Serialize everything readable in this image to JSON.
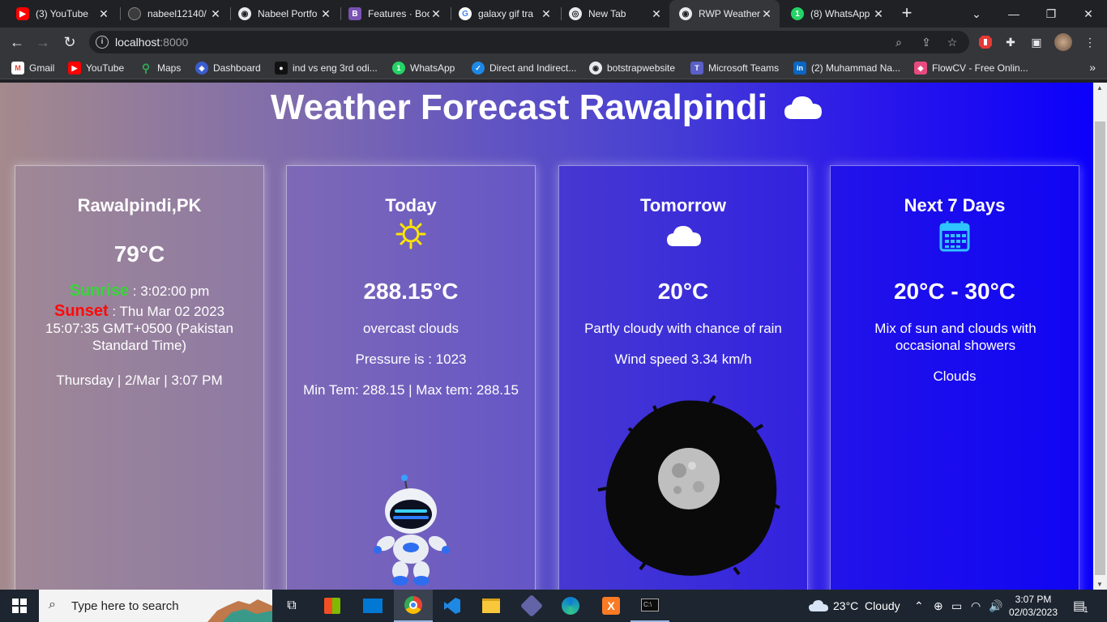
{
  "browser": {
    "tabs": [
      {
        "title": "(3) YouTube",
        "icon": "youtube-icon",
        "color": "#ff0000"
      },
      {
        "title": "nabeel12140/",
        "icon": "github-icon",
        "color": "#24292f"
      },
      {
        "title": "Nabeel Portfo",
        "icon": "globe-icon",
        "color": "#5f6368"
      },
      {
        "title": "Features · Boo",
        "icon": "bootstrap-icon",
        "color": "#7952b3"
      },
      {
        "title": "galaxy gif tra",
        "icon": "google-icon",
        "color": "#4285f4"
      },
      {
        "title": "New Tab",
        "icon": "chrome-icon",
        "color": "#5f6368"
      },
      {
        "title": "RWP Weather",
        "icon": "globe-icon",
        "color": "#5f6368"
      },
      {
        "title": "(8) WhatsApp",
        "icon": "whatsapp-icon",
        "color": "#25d366"
      }
    ],
    "url_host": "localhost",
    "url_port": ":8000",
    "bookmarks": [
      {
        "label": "Gmail",
        "icon": "gmail-icon",
        "color": "#ea4335"
      },
      {
        "label": "YouTube",
        "icon": "youtube-icon",
        "color": "#ff0000"
      },
      {
        "label": "Maps",
        "icon": "maps-icon",
        "color": "#34a853"
      },
      {
        "label": "Dashboard",
        "icon": "dashboard-icon",
        "color": "#3b5ccc"
      },
      {
        "label": "ind vs eng 3rd odi...",
        "icon": "page-icon",
        "color": "#111111"
      },
      {
        "label": "WhatsApp",
        "icon": "whatsapp-icon",
        "color": "#25d366"
      },
      {
        "label": "Direct and Indirect...",
        "icon": "messenger-icon",
        "color": "#1e88e5"
      },
      {
        "label": "botstrapwebsite",
        "icon": "globe-icon",
        "color": "#5f6368"
      },
      {
        "label": "Microsoft Teams",
        "icon": "teams-icon",
        "color": "#5b5fc7"
      },
      {
        "label": "(2) Muhammad Na...",
        "icon": "linkedin-icon",
        "color": "#0a66c2"
      },
      {
        "label": "FlowCV - Free Onlin...",
        "icon": "flowcv-icon",
        "color": "#e84a7f"
      }
    ]
  },
  "page": {
    "title": "Weather Forecast Rawalpindi",
    "current": {
      "city": "Rawalpindi,PK",
      "temp": "79°C",
      "sunrise_label": "Sunrise",
      "sunrise_value": " : 3:02:00 pm",
      "sunset_label": "Sunset",
      "sunset_value": " : Thu Mar 02 2023 15:07:35 GMT+0500 (Pakistan Standard Time)",
      "date": "Thursday | 2/Mar | 3:07 PM"
    },
    "today": {
      "heading": "Today",
      "temp": "288.15°C",
      "desc": "overcast clouds",
      "pressure": "Pressure is : 1023",
      "minmax": "Min Tem: 288.15 | Max tem: 288.15"
    },
    "tomorrow": {
      "heading": "Tomorrow",
      "temp": "20°C",
      "desc": "Partly cloudy with chance of rain",
      "wind": "Wind speed 3.34 km/h"
    },
    "week": {
      "heading": "Next 7 Days",
      "temp": "20°C - 30°C",
      "desc": "Mix of sun and clouds with occasional showers",
      "summary": "Clouds"
    }
  },
  "taskbar": {
    "search_placeholder": "Type here to search",
    "weather": "23°C  Cloudy",
    "time": "3:07 PM",
    "date": "02/03/2023",
    "notification_count": "1"
  }
}
